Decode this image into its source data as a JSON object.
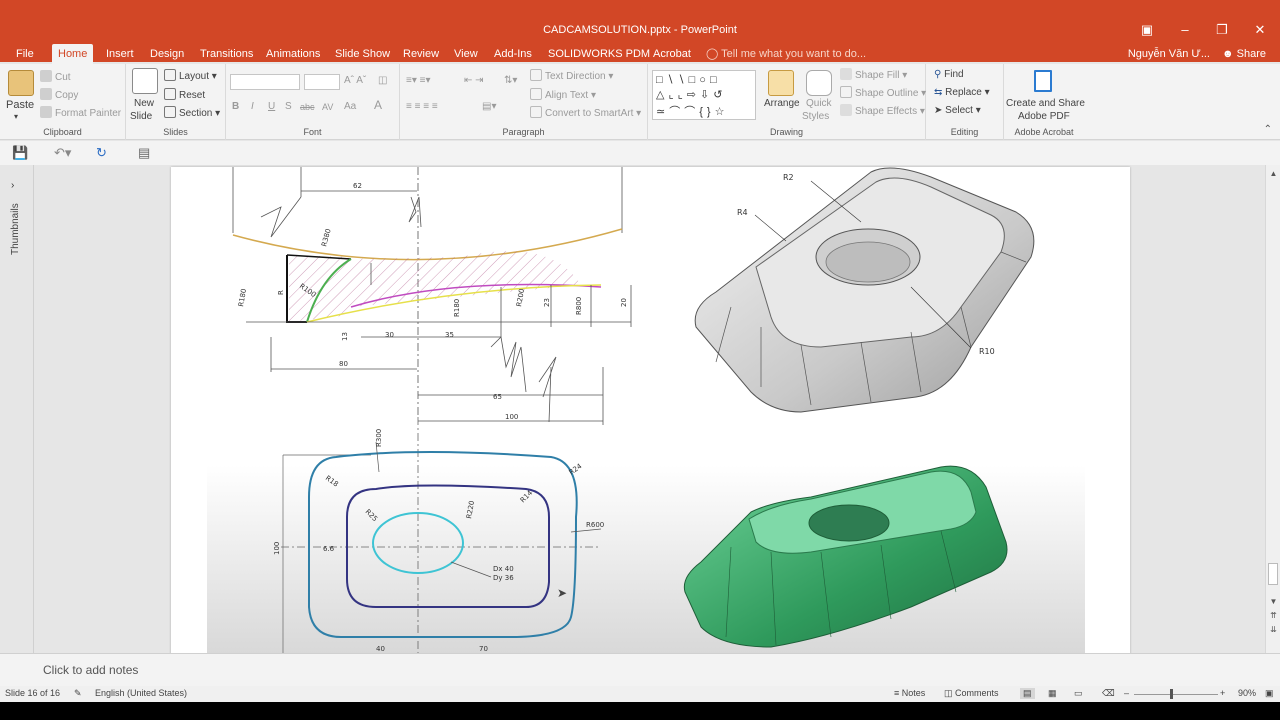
{
  "window": {
    "title": "CADCAMSOLUTION.pptx - PowerPoint",
    "user": "Nguyễn Văn Ư...",
    "share_label": "Share",
    "tell_me": "Tell me what you want to do...",
    "accent": "#d24726"
  },
  "tabs": [
    "File",
    "Home",
    "Insert",
    "Design",
    "Transitions",
    "Animations",
    "Slide Show",
    "Review",
    "View",
    "Add-Ins",
    "SOLIDWORKS PDM",
    "Acrobat"
  ],
  "ribbon": {
    "clipboard": {
      "label": "Clipboard",
      "paste": "Paste",
      "cut": "Cut",
      "copy": "Copy",
      "format_painter": "Format Painter"
    },
    "slides": {
      "label": "Slides",
      "new_slide_1": "New",
      "new_slide_2": "Slide",
      "layout": "Layout",
      "reset": "Reset",
      "section": "Section"
    },
    "font": {
      "label": "Font",
      "bold": "B",
      "italic": "I",
      "underline": "U",
      "shadow": "S",
      "strike": "abc",
      "spacing": "AV",
      "case": "Aa",
      "color": "A"
    },
    "paragraph": {
      "label": "Paragraph",
      "text_direction": "Text Direction",
      "align_text": "Align Text",
      "convert_smartart": "Convert to SmartArt"
    },
    "drawing": {
      "label": "Drawing",
      "arrange": "Arrange",
      "quick_styles_1": "Quick",
      "quick_styles_2": "Styles",
      "shape_fill": "Shape Fill",
      "shape_outline": "Shape Outline",
      "shape_effects": "Shape Effects"
    },
    "editing": {
      "label": "Editing",
      "find": "Find",
      "replace": "Replace",
      "select": "Select"
    },
    "acrobat": {
      "label": "Adobe Acrobat",
      "create_1": "Create and Share",
      "create_2": "Adobe PDF"
    }
  },
  "sidebar": {
    "thumbnails": "Thumbnails"
  },
  "slide": {
    "drawing_labels": {
      "d62": "62",
      "r380": "R380",
      "r100": "R100",
      "r180": "R180",
      "r": "R",
      "d30": "30",
      "d35": "35",
      "d13": "13",
      "d80": "80",
      "r180b": "R180",
      "r200": "R200",
      "d23": "23",
      "r800": "R800",
      "d20": "20",
      "d65": "65",
      "d100": "100",
      "r300": "R300",
      "r18": "R18",
      "r24": "R24",
      "r25": "R25",
      "r220": "R220",
      "r14": "R14",
      "r600": "R600",
      "d100v": "100",
      "d66": "6.6",
      "dx": "Dx 40",
      "dy": "Dy 36",
      "d40": "40",
      "d70": "70"
    },
    "model_labels": {
      "r2": "R2",
      "r4": "R4",
      "r10": "R10"
    }
  },
  "notes_placeholder": "Click to add notes",
  "status": {
    "slide": "Slide 16 of 16",
    "language": "English (United States)",
    "notes": "Notes",
    "comments": "Comments",
    "zoom": "90%"
  }
}
